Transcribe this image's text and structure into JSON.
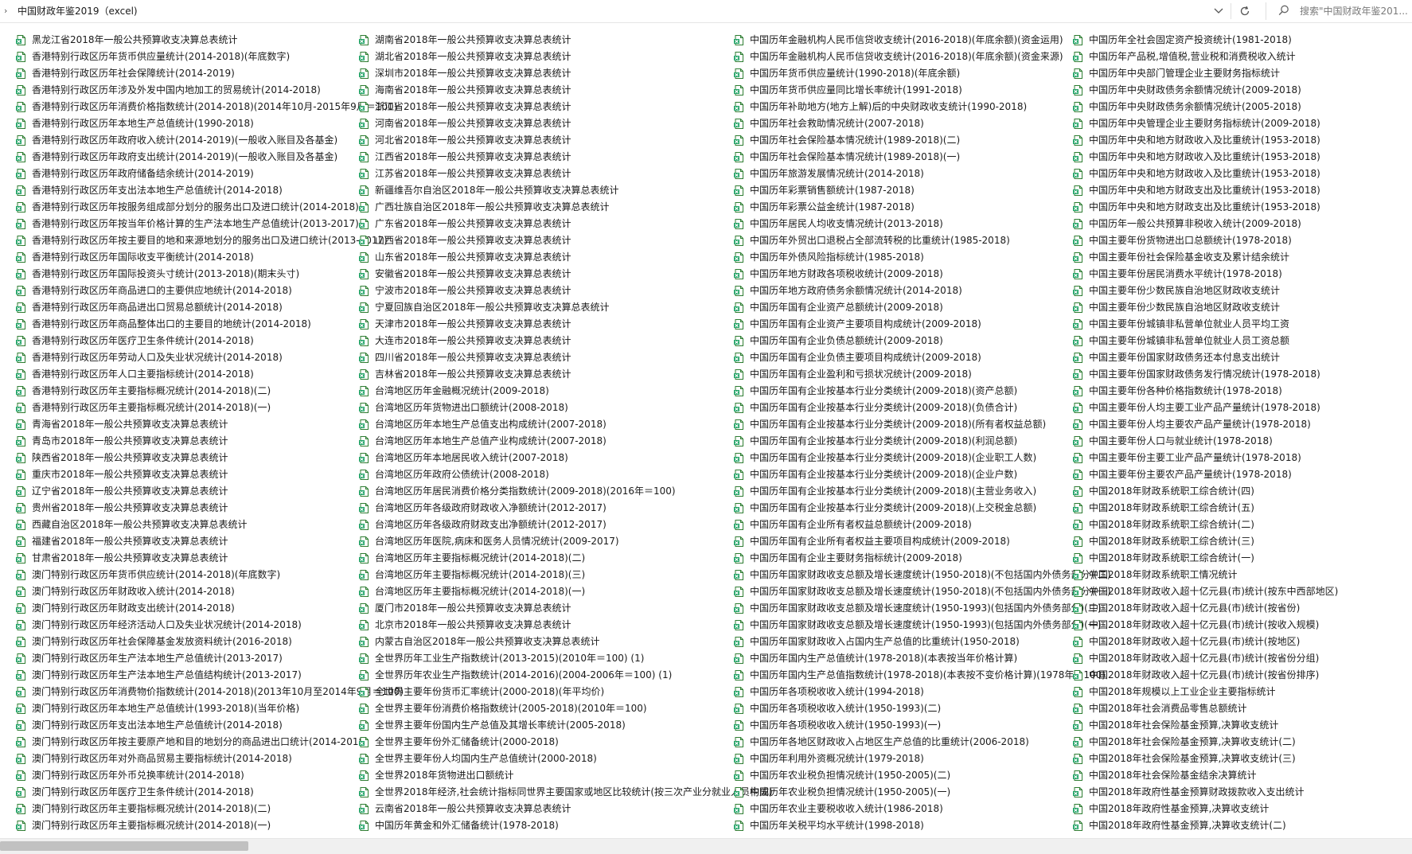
{
  "address": {
    "path": "中国财政年鉴2019（excel)",
    "search_placeholder": "搜索\"中国财政年鉴201..."
  },
  "icons": {
    "file": "excel-sheet-icon",
    "refresh": "refresh-icon",
    "search": "search-icon",
    "dropdown": "chevron-down-icon",
    "expand": "chevron-right-icon"
  },
  "columns": [
    [
      "黑龙江省2018年一般公共预算收支决算总表统计",
      "香港特别行政区历年货币供应量统计(2014-2018)(年底数字)",
      "香港特别行政区历年社会保障统计(2014-2019)",
      "香港特别行政区历年涉及外发中国内地加工的贸易统计(2014-2018)",
      "香港特别行政区历年消费价格指数统计(2014-2018)(2014年10月-2015年9月＝100)",
      "香港特别行政区历年本地生产总值统计(1990-2018)",
      "香港特别行政区历年政府收入统计(2014-2019)(一般收入账目及各基金)",
      "香港特别行政区历年政府支出统计(2014-2019)(一般收入账目及各基金)",
      "香港特别行政区历年政府储备结余统计(2014-2019)",
      "香港特别行政区历年支出法本地生产总值统计(2014-2018)",
      "香港特别行政区历年按服务组成部分划分的服务出口及进口统计(2014-2018)",
      "香港特别行政区历年按当年价格计算的生产法本地生产总值统计(2013-2017)",
      "香港特别行政区历年按主要目的地和来源地划分的服务出口及进口统计(2013-2017)",
      "香港特别行政区历年国际收支平衡统计(2014-2018)",
      "香港特别行政区历年国际投资头寸统计(2013-2018)(期末头寸)",
      "香港特别行政区历年商品进口的主要供应地统计(2014-2018)",
      "香港特别行政区历年商品进出口贸易总额统计(2014-2018)",
      "香港特别行政区历年商品整体出口的主要目的地统计(2014-2018)",
      "香港特别行政区历年医疗卫生条件统计(2014-2018)",
      "香港特别行政区历年劳动人口及失业状况统计(2014-2018)",
      "香港特别行政区历年人口主要指标统计(2014-2018)",
      "香港特别行政区历年主要指标概况统计(2014-2018)(二)",
      "香港特别行政区历年主要指标概况统计(2014-2018)(一)",
      "青海省2018年一般公共预算收支决算总表统计",
      "青岛市2018年一般公共预算收支决算总表统计",
      "陕西省2018年一般公共预算收支决算总表统计",
      "重庆市2018年一般公共预算收支决算总表统计",
      "辽宁省2018年一般公共预算收支决算总表统计",
      "贵州省2018年一般公共预算收支决算总表统计",
      "西藏自治区2018年一般公共预算收支决算总表统计",
      "福建省2018年一般公共预算收支决算总表统计",
      "甘肃省2018年一般公共预算收支决算总表统计",
      "澳门特别行政区历年货币供应统计(2014-2018)(年底数字)",
      "澳门特别行政区历年财政收入统计(2014-2018)",
      "澳门特别行政区历年财政支出统计(2014-2018)",
      "澳门特别行政区历年经济活动人口及失业状况统计(2014-2018)",
      "澳门特别行政区历年社会保障基金发放资料统计(2016-2018)",
      "澳门特别行政区历年生产法本地生产总值统计(2013-2017)",
      "澳门特别行政区历年生产法本地生产总值结构统计(2013-2017)",
      "澳门特别行政区历年消费物价指数统计(2014-2018)(2013年10月至2014年9月＝100)",
      "澳门特别行政区历年本地生产总值统计(1993-2018)(当年价格)",
      "澳门特别行政区历年支出法本地生产总值统计(2014-2018)",
      "澳门特别行政区历年按主要原产地和目的地划分的商品进出口统计(2014-2018)",
      "澳门特别行政区历年对外商品贸易主要指标统计(2014-2018)",
      "澳门特别行政区历年外币兑换率统计(2014-2018)",
      "澳门特别行政区历年医疗卫生条件统计(2014-2018)",
      "澳门特别行政区历年主要指标概况统计(2014-2018)(二)",
      "澳门特别行政区历年主要指标概况统计(2014-2018)(一)"
    ],
    [
      "湖南省2018年一般公共预算收支决算总表统计",
      "湖北省2018年一般公共预算收支决算总表统计",
      "深圳市2018年一般公共预算收支决算总表统计",
      "海南省2018年一般公共预算收支决算总表统计",
      "浙江省2018年一般公共预算收支决算总表统计",
      "河南省2018年一般公共预算收支决算总表统计",
      "河北省2018年一般公共预算收支决算总表统计",
      "江西省2018年一般公共预算收支决算总表统计",
      "江苏省2018年一般公共预算收支决算总表统计",
      "新疆维吾尔自治区2018年一般公共预算收支决算总表统计",
      "广西壮族自治区2018年一般公共预算收支决算总表统计",
      "广东省2018年一般公共预算收支决算总表统计",
      "山西省2018年一般公共预算收支决算总表统计",
      "山东省2018年一般公共预算收支决算总表统计",
      "安徽省2018年一般公共预算收支决算总表统计",
      "宁波市2018年一般公共预算收支决算总表统计",
      "宁夏回族自治区2018年一般公共预算收支决算总表统计",
      "天津市2018年一般公共预算收支决算总表统计",
      "大连市2018年一般公共预算收支决算总表统计",
      "四川省2018年一般公共预算收支决算总表统计",
      "吉林省2018年一般公共预算收支决算总表统计",
      "台湾地区历年金融概况统计(2009-2018)",
      "台湾地区历年货物进出口额统计(2008-2018)",
      "台湾地区历年本地生产总值支出构成统计(2007-2018)",
      "台湾地区历年本地生产总值产业构成统计(2007-2018)",
      "台湾地区历年本地居民收入统计(2007-2018)",
      "台湾地区历年政府公债统计(2008-2018)",
      "台湾地区历年居民消费价格分类指数统计(2009-2018)(2016年＝100)",
      "台湾地区历年各级政府财政收入净额统计(2012-2017)",
      "台湾地区历年各级政府财政支出净额统计(2012-2017)",
      "台湾地区历年医院,病床和医务人员情况统计(2009-2017)",
      "台湾地区历年主要指标概况统计(2014-2018)(二)",
      "台湾地区历年主要指标概况统计(2014-2018)(三)",
      "台湾地区历年主要指标概况统计(2014-2018)(一)",
      "厦门市2018年一般公共预算收支决算总表统计",
      "北京市2018年一般公共预算收支决算总表统计",
      "内蒙古自治区2018年一般公共预算收支决算总表统计",
      "全世界历年工业生产指数统计(2013-2015)(2010年＝100) (1)",
      "全世界历年农业生产指数统计(2014-2016)(2004-2006年＝100) (1)",
      "全世界主要年份货币汇率统计(2000-2018)(年平均价)",
      "全世界主要年份消费价格指数统计(2005-2018)(2010年＝100)",
      "全世界主要年份国内生产总值及其增长率统计(2005-2018)",
      "全世界主要年份外汇储备统计(2000-2018)",
      "全世界主要年份人均国内生产总值统计(2000-2018)",
      "全世界2018年货物进出口额统计",
      "全世界2018年经济,社会统计指标同世界主要国家或地区比较统计(按三次产业分就业人员构成)",
      "云南省2018年一般公共预算收支决算总表统计",
      "中国历年黄金和外汇储备统计(1978-2018)"
    ],
    [
      "中国历年金融机构人民币信贷收支统计(2016-2018)(年底余额)(资金运用)",
      "中国历年金融机构人民币信贷收支统计(2016-2018)(年底余额)(资金来源)",
      "中国历年货币供应量统计(1990-2018)(年底余额)",
      "中国历年货币供应量同比增长率统计(1991-2018)",
      "中国历年补助地方(地方上解)后的中央财政收支统计(1990-2018)",
      "中国历年社会救助情况统计(2007-2018)",
      "中国历年社会保险基本情况统计(1989-2018)(二)",
      "中国历年社会保险基本情况统计(1989-2018)(一)",
      "中国历年旅游发展情况统计(2014-2018)",
      "中国历年彩票销售额统计(1987-2018)",
      "中国历年彩票公益金统计(1987-2018)",
      "中国历年居民人均收支情况统计(2013-2018)",
      "中国历年外贸出口退税占全部流转税的比重统计(1985-2018)",
      "中国历年外债风险指标统计(1985-2018)",
      "中国历年地方财政各项税收统计(2009-2018)",
      "中国历年地方政府债务余额情况统计(2014-2018)",
      "中国历年国有企业资产总额统计(2009-2018)",
      "中国历年国有企业资产主要项目构成统计(2009-2018)",
      "中国历年国有企业负债总额统计(2009-2018)",
      "中国历年国有企业负债主要项目构成统计(2009-2018)",
      "中国历年国有企业盈利和亏损状况统计(2009-2018)",
      "中国历年国有企业按基本行业分类统计(2009-2018)(资产总额)",
      "中国历年国有企业按基本行业分类统计(2009-2018)(负债合计)",
      "中国历年国有企业按基本行业分类统计(2009-2018)(所有者权益总额)",
      "中国历年国有企业按基本行业分类统计(2009-2018)(利润总额)",
      "中国历年国有企业按基本行业分类统计(2009-2018)(企业职工人数)",
      "中国历年国有企业按基本行业分类统计(2009-2018)(企业户数)",
      "中国历年国有企业按基本行业分类统计(2009-2018)(主营业务收入)",
      "中国历年国有企业按基本行业分类统计(2009-2018)(上交税金总额)",
      "中国历年国有企业所有者权益总额统计(2009-2018)",
      "中国历年国有企业所有者权益主要项目构成统计(2009-2018)",
      "中国历年国有企业主要财务指标统计(2009-2018)",
      "中国历年国家财政收支总额及增长速度统计(1950-2018)(不包括国内外债务部分)(二)",
      "中国历年国家财政收支总额及增长速度统计(1950-2018)(不包括国内外债务部分)(一)",
      "中国历年国家财政收支总额及增长速度统计(1950-1993)(包括国内外债务部分)(二)",
      "中国历年国家财政收支总额及增长速度统计(1950-1993)(包括国内外债务部分)(一)",
      "中国历年国家财政收入占国内生产总值的比重统计(1950-2018)",
      "中国历年国内生产总值统计(1978-2018)(本表按当年价格计算)",
      "中国历年国内生产总值指数统计(1978-2018)(本表按不变价格计算)(1978年＝100)",
      "中国历年各项税收收入统计(1994-2018)",
      "中国历年各项税收收入统计(1950-1993)(二)",
      "中国历年各项税收收入统计(1950-1993)(一)",
      "中国历年各地区财政收入占地区生产总值的比重统计(2006-2018)",
      "中国历年利用外资概况统计(1979-2018)",
      "中国历年农业税负担情况统计(1950-2005)(二)",
      "中国历年农业税负担情况统计(1950-2005)(一)",
      "中国历年农业主要税收收入统计(1986-2018)",
      "中国历年关税平均水平统计(1998-2018)"
    ],
    [
      "中国历年全社会固定资产投资统计(1981-2018)",
      "中国历年产品税,增值税,营业税和消费税收入统计",
      "中国历年中央部门管理企业主要财务指标统计",
      "中国历年中央财政债务余额情况统计(2009-2018)",
      "中国历年中央财政债务余额情况统计(2005-2018)",
      "中国历年中央管理企业主要财务指标统计(2009-2018)",
      "中国历年中央和地方财政收入及比重统计(1953-2018)",
      "中国历年中央和地方财政收入及比重统计(1953-2018)",
      "中国历年中央和地方财政收入及比重统计(1953-2018)",
      "中国历年中央和地方财政支出及比重统计(1953-2018)",
      "中国历年中央和地方财政支出及比重统计(1953-2018)",
      "中国历年一般公共预算非税收入统计(2009-2018)",
      "中国主要年份货物进出口总额统计(1978-2018)",
      "中国主要年份社会保险基金收支及累计结余统计",
      "中国主要年份居民消费水平统计(1978-2018)",
      "中国主要年份少数民族自治地区财政收支统计",
      "中国主要年份少数民族自治地区财政收支统计",
      "中国主要年份城镇非私营单位就业人员平均工资",
      "中国主要年份城镇非私营单位就业人员工资总额",
      "中国主要年份国家财政债务还本付息支出统计",
      "中国主要年份国家财政债务发行情况统计(1978-2018)",
      "中国主要年份各种价格指数统计(1978-2018)",
      "中国主要年份人均主要工业产品产量统计(1978-2018)",
      "中国主要年份人均主要农产品产量统计(1978-2018)",
      "中国主要年份人口与就业统计(1978-2018)",
      "中国主要年份主要工业产品产量统计(1978-2018)",
      "中国主要年份主要农产品产量统计(1978-2018)",
      "中国2018年财政系统职工综合统计(四)",
      "中国2018年财政系统职工综合统计(五)",
      "中国2018年财政系统职工综合统计(二)",
      "中国2018年财政系统职工综合统计(三)",
      "中国2018年财政系统职工综合统计(一)",
      "中国2018年财政系统职工情况统计",
      "中国2018年财政收入超十亿元县(市)统计(按东中西部地区)",
      "中国2018年财政收入超十亿元县(市)统计(按省份)",
      "中国2018年财政收入超十亿元县(市)统计(按收入规模)",
      "中国2018年财政收入超十亿元县(市)统计(按地区)",
      "中国2018年财政收入超十亿元县(市)统计(按省份分组)",
      "中国2018年财政收入超十亿元县(市)统计(按省份排序)",
      "中国2018年规模以上工业企业主要指标统计",
      "中国2018年社会消费品零售总额统计",
      "中国2018年社会保险基金预算,决算收支统计",
      "中国2018年社会保险基金预算,决算收支统计(二)",
      "中国2018年社会保险基金预算,决算收支统计(三)",
      "中国2018年社会保险基金结余决算统计",
      "中国2018年政府性基金预算财政拨款收入支出统计",
      "中国2018年政府性基金预算,决算收支统计",
      "中国2018年政府性基金预算,决算收支统计(二)"
    ]
  ]
}
